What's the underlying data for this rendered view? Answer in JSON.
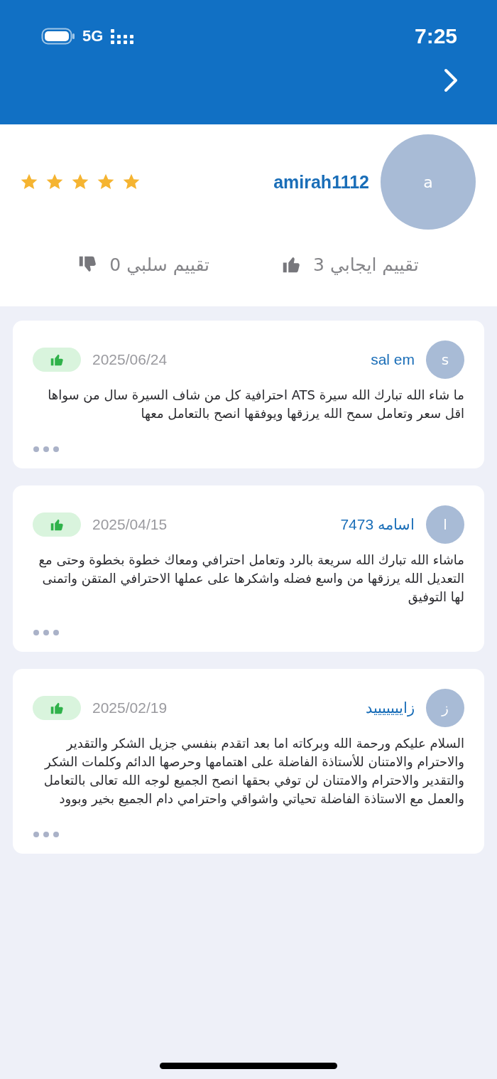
{
  "status_bar": {
    "network": "5G",
    "time": "7:25"
  },
  "profile": {
    "avatar_letter": "a",
    "username": "amirah1112",
    "stars": 5,
    "positive_label": "تقييم ايجابي 3",
    "negative_label": "تقييم سلبي 0"
  },
  "reviews": [
    {
      "avatar_letter": "s",
      "author": "sal em",
      "date": "2025/06/24",
      "positive": true,
      "text": "ما شاء الله تبارك الله سيرة ATS احترافية كل من شاف السيرة سال من سواها اقل سعر وتعامل سمح الله يرزقها ويوفقها انصح بالتعامل معها"
    },
    {
      "avatar_letter": "ا",
      "author": "اسامه 7473",
      "date": "2025/04/15",
      "positive": true,
      "text": "ماشاء الله تبارك الله سريعة بالرد وتعامل احترافي ومعاك خطوة بخطوة وحتى مع التعديل الله يرزقها من واسع فضله واشكرها على عملها الاحترافي المتقن واتمنى لها التوفيق"
    },
    {
      "avatar_letter": "ز",
      "author": "زايييييييد",
      "date": "2025/02/19",
      "positive": true,
      "text": "السلام عليكم ورحمة الله وبركاته اما بعد اتقدم بنفسي جزيل الشكر والتقدير والاحترام والامتنان للأستاذة الفاضلة على اهتمامها وحرصها الدائم وكلمات الشكر والتقدير والاحترام والامتنان لن توفي بحقها انصح الجميع لوجه الله تعالى بالتعامل والعمل مع الاستاذة الفاضلة تحياتي واشواقي واحترامي دام الجميع بخير وبوود"
    }
  ]
}
